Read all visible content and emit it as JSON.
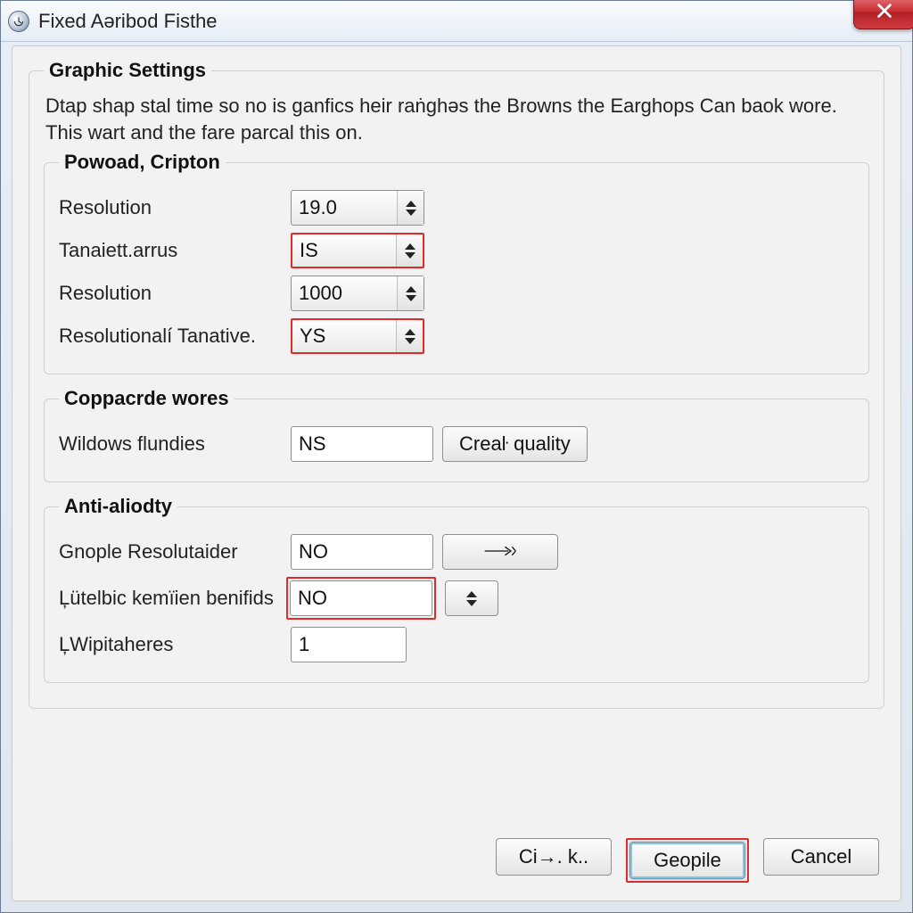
{
  "window": {
    "title": "Fixed Aəribod Fisthe"
  },
  "sections": {
    "graphic": {
      "legend": "Graphic Settings",
      "description": "Dtap shap stal time so no is ganfics heir raṅghəs the Browns the Earghops Can baok wore. This wart and the fare parcal this on."
    },
    "powoad": {
      "legend": "Powoad, Cripton",
      "rows": {
        "resolution1": {
          "label": "Resolution",
          "value": "19.0"
        },
        "tanaiet": {
          "label": "Tanaiett.arrus",
          "value": "IS"
        },
        "resolution2": {
          "label": "Resolution",
          "value": "1000"
        },
        "resTan": {
          "label": "Resolutionalí Tanative.",
          "value": "YS"
        }
      }
    },
    "coppa": {
      "legend": "Coppacrde wores",
      "row": {
        "label": "Wildows flundies",
        "value": "NS",
        "button": "Creaŀ quality"
      }
    },
    "anti": {
      "legend": "Anti-aliodty",
      "rows": {
        "gno": {
          "label": "Gnople Resolutaider",
          "value": "NO"
        },
        "lute": {
          "label": "Ļütelbic kemïien benifids",
          "value": "NO"
        },
        "lwip": {
          "label": "ĻWipitaheres",
          "value": "1"
        }
      }
    }
  },
  "footer": {
    "ci": "Ci→. k..",
    "geopile": "Geopile",
    "cancel": "Cancel"
  }
}
